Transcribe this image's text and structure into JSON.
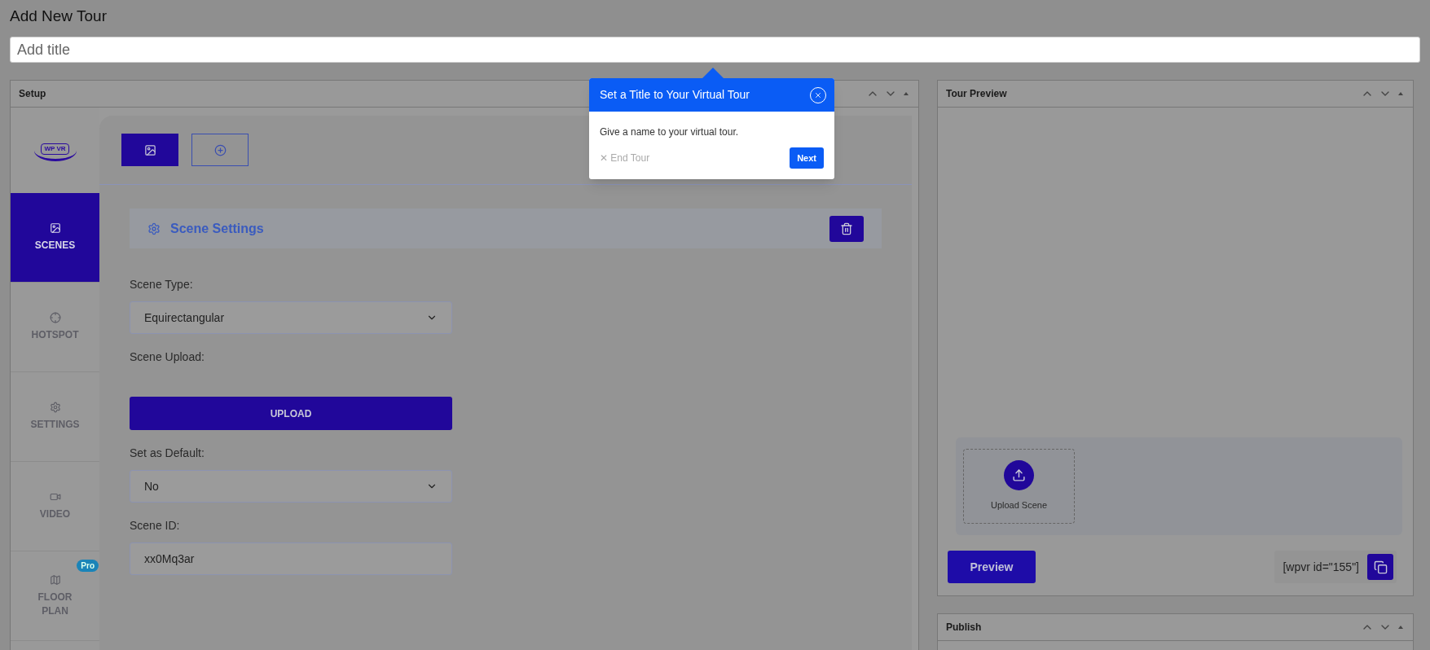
{
  "page_title": "Add New Tour",
  "title_field": {
    "placeholder": "Add title"
  },
  "setup": {
    "title": "Setup",
    "sidebar": [
      {
        "label": "SCENES",
        "selected": true
      },
      {
        "label": "HOTSPOT",
        "selected": false
      },
      {
        "label": "SETTINGS",
        "selected": false
      },
      {
        "label": "VIDEO",
        "selected": false
      },
      {
        "label": "FLOOR PLAN",
        "selected": false,
        "badge": "Pro"
      }
    ],
    "logo": "WP VR",
    "scene_tabs": [
      {
        "kind": "scene",
        "selected": true
      },
      {
        "kind": "add",
        "selected": false
      }
    ],
    "section_title": "Scene Settings",
    "fields": [
      {
        "kind": "select",
        "label": "Scene Type:",
        "value": "Equirectangular"
      },
      {
        "kind": "button",
        "label": "Scene Upload:",
        "button": "UPLOAD"
      },
      {
        "kind": "select",
        "label": "Set as Default:",
        "value": "No"
      },
      {
        "kind": "input",
        "label": "Scene ID:",
        "value": "xx0Mq3ar"
      }
    ]
  },
  "preview": {
    "title": "Tour Preview",
    "upload_label": "Upload Scene",
    "preview_button": "Preview",
    "shortcode": "[wpvr id=\"155\"]"
  },
  "publish": {
    "title": "Publish"
  },
  "tour_popup": {
    "title": "Set a Title to Your Virtual Tour",
    "text": "Give a name to your virtual tour.",
    "end_label": "✕ End Tour",
    "next": "Next"
  }
}
